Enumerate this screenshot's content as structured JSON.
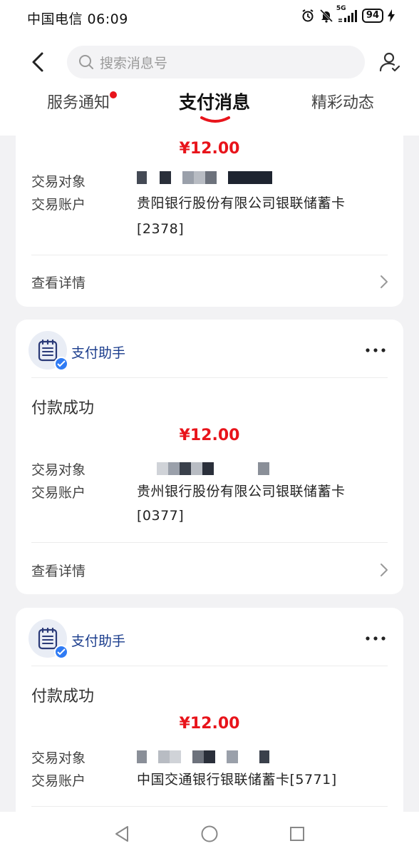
{
  "status_bar": {
    "carrier_time": "中国电信 06:09",
    "network": "5G",
    "battery": "94"
  },
  "header": {
    "search_placeholder": "搜索消息号",
    "tabs": [
      {
        "label": "服务通知",
        "has_dot": true
      },
      {
        "label": "支付消息",
        "active": true
      },
      {
        "label": "精彩动态"
      }
    ]
  },
  "cards": [
    {
      "amount": "¥12.00",
      "rows": [
        {
          "label": "交易对象",
          "value": ""
        },
        {
          "label": "交易账户",
          "value": "贵阳银行股份有限公司银联储蓄卡",
          "value2": "[2378]"
        }
      ],
      "detail_label": "查看详情"
    },
    {
      "sender": "支付助手",
      "status": "付款成功",
      "amount": "¥12.00",
      "rows": [
        {
          "label": "交易对象",
          "value": ""
        },
        {
          "label": "交易账户",
          "value": "贵州银行股份有限公司银联储蓄卡",
          "value2": "[0377]"
        }
      ],
      "detail_label": "查看详情"
    },
    {
      "sender": "支付助手",
      "status": "付款成功",
      "amount": "¥12.00",
      "rows": [
        {
          "label": "交易对象",
          "value": ""
        },
        {
          "label": "交易账户",
          "value": "中国交通银行银联储蓄卡[5771]"
        }
      ]
    }
  ],
  "colors": {
    "accent_red": "#e8141b",
    "sender_blue": "#1a3c8c",
    "badge_blue": "#2f7bf4",
    "background": "#f2f2f4"
  },
  "icons": [
    "back-arrow-icon",
    "search-icon",
    "user-settings-icon",
    "receipt-icon",
    "verified-badge-icon",
    "more-icon",
    "chevron-right-icon",
    "nav-back-icon",
    "nav-home-icon",
    "nav-recent-icon"
  ]
}
